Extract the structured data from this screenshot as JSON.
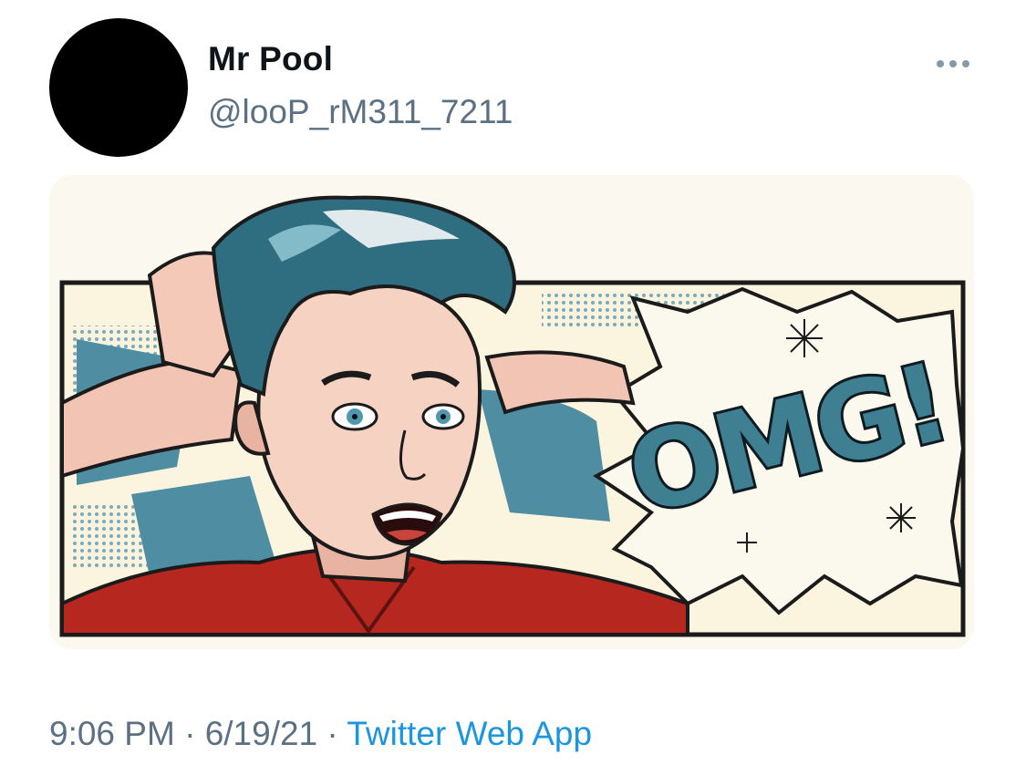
{
  "author": {
    "display_name": "Mr Pool",
    "handle": "@looP_rM311_7211"
  },
  "more_icon": "more-horizontal-icon",
  "media": {
    "description_icon": "comic-image",
    "exclamation_text": "OMG!"
  },
  "meta": {
    "time": "9:06 PM",
    "separator": " · ",
    "date": "6/19/21",
    "source": "Twitter Web App"
  },
  "colors": {
    "handle_gray": "#5b7083",
    "link_blue": "#1b95e0",
    "comic_teal": "#3e7f92",
    "comic_red": "#b6281f",
    "comic_cream": "#fbf5e0"
  }
}
